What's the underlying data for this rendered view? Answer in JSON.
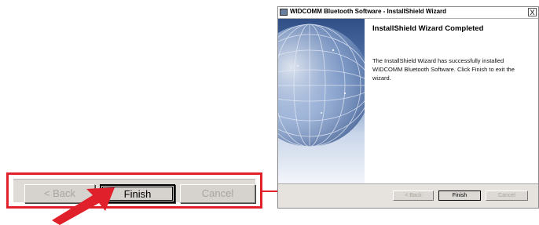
{
  "callout": {
    "back_label": "< Back",
    "finish_label": "Finish",
    "cancel_label": "Cancel"
  },
  "window": {
    "title": "WIDCOMM Bluetooth Software - InstallShield Wizard",
    "close_glyph": "X",
    "heading": "InstallShield Wizard Completed",
    "body": "The InstallShield Wizard has successfully installed WIDCOMM Bluetooth Software. Click Finish to exit the wizard.",
    "back_label": "< Back",
    "finish_label": "Finish",
    "cancel_label": "Cancel"
  },
  "colors": {
    "callout_border": "#e0202a",
    "arrow": "#e0202a"
  }
}
